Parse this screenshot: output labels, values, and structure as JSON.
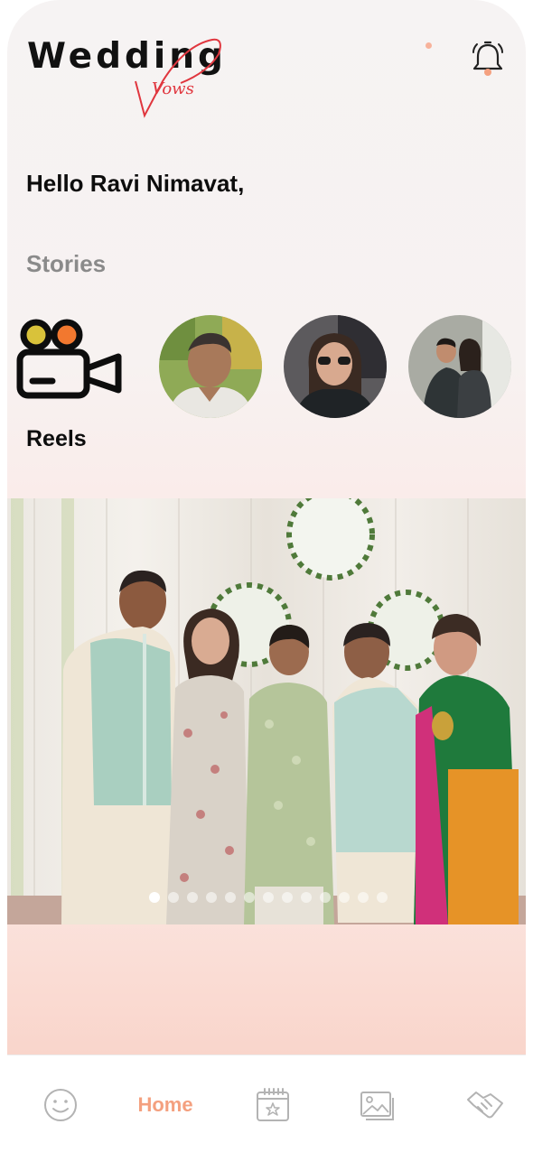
{
  "app": {
    "logo_text": "Wedding",
    "logo_script": "Vows"
  },
  "header": {
    "greeting": "Hello Ravi Nimavat,"
  },
  "stories": {
    "title": "Stories",
    "reels_label": "Reels",
    "count": 3
  },
  "carousel": {
    "slide_count": 13,
    "active_index": 0
  },
  "tabbar": {
    "items": [
      {
        "icon": "smiley-icon",
        "label": ""
      },
      {
        "icon": "",
        "label": "Home",
        "active": true
      },
      {
        "icon": "calendar-star-icon",
        "label": ""
      },
      {
        "icon": "gallery-icon",
        "label": ""
      },
      {
        "icon": "handshake-icon",
        "label": ""
      }
    ]
  },
  "colors": {
    "accent": "#f4a07f",
    "logo_red": "#e0363e",
    "reels_dot_1": "#d9c23a",
    "reels_dot_2": "#f2782f"
  }
}
